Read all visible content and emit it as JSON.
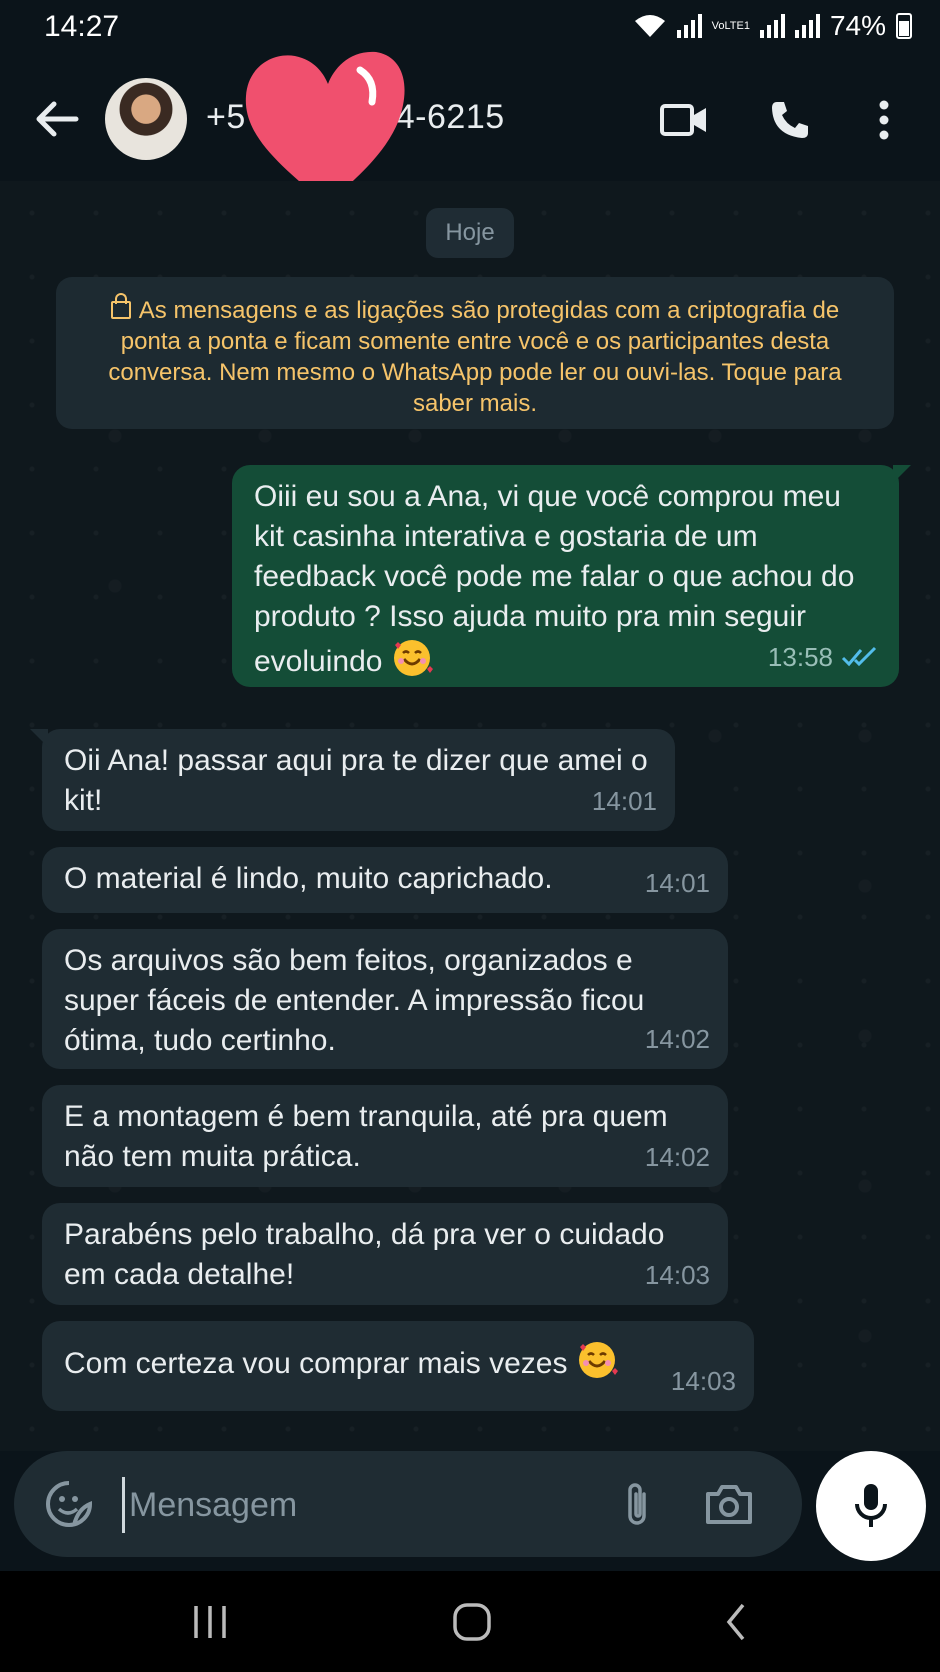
{
  "status_bar": {
    "time": "14:27",
    "network": "VoLTE1",
    "battery": "74%"
  },
  "header": {
    "contact_name": "+5",
    "contact_number": "4-6215"
  },
  "chat": {
    "date_divider": "Hoje",
    "encryption_notice": "As mensagens e as ligações são protegidas com a criptografia de ponta a ponta e ficam somente entre você e os participantes desta conversa. Nem mesmo o WhatsApp pode ler ou ouvi-las. Toque para saber mais.",
    "messages": [
      {
        "direction": "out",
        "text": "Oiii eu sou a Ana, vi que você comprou meu kit casinha interativa e gostaria de um feedback você pode me falar o que achou do produto ? Isso ajuda muito pra min seguir evoluindo",
        "emoji": "smiling-face-with-hearts",
        "time": "13:58",
        "status": "read"
      },
      {
        "direction": "in",
        "text": "Oii Ana! passar aqui pra te dizer que amei o kit!",
        "time": "14:01"
      },
      {
        "direction": "in",
        "text": "O material é lindo, muito caprichado.",
        "time": "14:01"
      },
      {
        "direction": "in",
        "text": "Os arquivos são bem feitos, organizados e super fáceis de entender. A impressão ficou ótima, tudo certinho.",
        "time": "14:02"
      },
      {
        "direction": "in",
        "text": "E a montagem é bem tranquila, até pra quem não tem muita prática.",
        "time": "14:02"
      },
      {
        "direction": "in",
        "text": "Parabéns pelo trabalho, dá pra ver o cuidado em cada detalhe!",
        "time": "14:03"
      },
      {
        "direction": "in",
        "text": "Com certeza vou comprar mais vezes",
        "emoji": "smiling-face-with-hearts",
        "time": "14:03"
      }
    ]
  },
  "input": {
    "placeholder": "Mensagem"
  },
  "colors": {
    "outgoing_bubble": "#144d37",
    "incoming_bubble": "#1f2c33",
    "read_ticks": "#53bdeb",
    "notice_text": "#f6c46a",
    "heart_sticker": "#f0506e"
  }
}
